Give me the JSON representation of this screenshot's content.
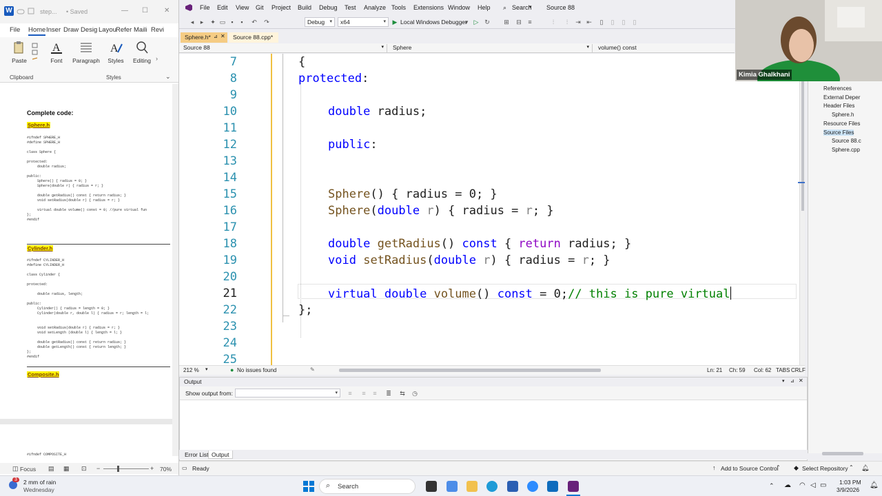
{
  "word": {
    "title_doc": "step...",
    "title_saved": "• Saved",
    "tabs": [
      "File",
      "Home",
      "Inser",
      "Draw",
      "Desig",
      "Layou",
      "Refer",
      "Maili",
      "Revi"
    ],
    "ribbon": {
      "paste": "Paste",
      "font": "Font",
      "paragraph": "Paragraph",
      "styles": "Styles",
      "editing": "Editing",
      "clipboard_group": "Clipboard",
      "styles_group": "Styles"
    },
    "doc": {
      "heading": "Complete code:",
      "sphere_file": "Sphere.h",
      "sphere_code": "#ifndef SPHERE_H\n#define SPHERE_H\n\nclass Sphere {\n\nprotected:\n     double radius;\n\npublic:\n     Sphere() { radius = 0; }\n     Sphere(double r) { radius = r; }\n\n     double getRadius() const { return radius; }\n     void setRadius(double r) { radius = r; }\n\n     virtual double volume() const = 0; //pure virtual fun\n};\n#endif",
      "cylinder_file": "Cylinder.h",
      "cylinder_code": "#ifndef CYLINDER_H\n#define CYLINDER_H\n\nclass Cylinder {\n\nprotected:\n\n     double radius, length;\n\npublic:\n     Cylinder() { radius = length = 0; }\n     Cylinder(double r, double l) { radius = r; length = l;\n\n\n     void setRadius(double r) { radius = r; }\n     void setLength (double l) { length = l; }\n\n     double getRadius() const { return radius; }\n     double getLength() const { return length; }\n};\n#endif",
      "composite_file": "Composite.h",
      "composite_code": "#ifndef COMPOSITE_H"
    },
    "status": {
      "focus": "Focus",
      "zoom": "70%"
    }
  },
  "vs": {
    "menu": [
      "File",
      "Edit",
      "View",
      "Git",
      "Project",
      "Build",
      "Debug",
      "Test",
      "Analyze",
      "Tools",
      "Extensions",
      "Window",
      "Help"
    ],
    "search_label": "Search",
    "solution_title": "Source 88",
    "config": "Debug",
    "platform": "x64",
    "run_label": "Local Windows Debugger",
    "tabs": [
      {
        "label": "Sphere.h*"
      },
      {
        "label": "Source 88.cpp*"
      }
    ],
    "nav": {
      "project": "Source 88",
      "scope": "Sphere",
      "member": "volume() const"
    },
    "code_lines": [
      {
        "n": "7",
        "text": "{"
      },
      {
        "n": "8",
        "text": "protected:"
      },
      {
        "n": "9",
        "text": ""
      },
      {
        "n": "10",
        "text": "double radius;"
      },
      {
        "n": "11",
        "text": ""
      },
      {
        "n": "12",
        "text": "public:"
      },
      {
        "n": "13",
        "text": ""
      },
      {
        "n": "14",
        "text": ""
      },
      {
        "n": "15",
        "text": "Sphere() { radius = 0; }"
      },
      {
        "n": "16",
        "text": "Sphere(double r) { radius = r; }"
      },
      {
        "n": "17",
        "text": ""
      },
      {
        "n": "18",
        "text": "double getRadius() const { return radius; }"
      },
      {
        "n": "19",
        "text": "void setRadius(double r) { radius = r; }"
      },
      {
        "n": "20",
        "text": ""
      },
      {
        "n": "21",
        "text": "virtual double volume() const = 0;// this is pure virtual"
      },
      {
        "n": "22",
        "text": "};"
      },
      {
        "n": "23",
        "text": ""
      },
      {
        "n": "24",
        "text": ""
      },
      {
        "n": "25",
        "text": ""
      }
    ],
    "editor_status": {
      "zoom": "212 %",
      "issues": "No issues found",
      "ln": "Ln: 21",
      "ch": "Ch: 59",
      "col": "Col: 62",
      "tabs": "TABS",
      "eol": "CRLF"
    },
    "output": {
      "title": "Output",
      "show_from": "Show output from:"
    },
    "bottom_tabs": [
      "Error List",
      "Output"
    ],
    "solution_items": [
      {
        "label": "References",
        "level": 1
      },
      {
        "label": "External Deper",
        "level": 1
      },
      {
        "label": "Header Files",
        "level": 1
      },
      {
        "label": "Sphere.h",
        "level": 2
      },
      {
        "label": "Resource Files",
        "level": 1
      },
      {
        "label": "Source Files",
        "level": 1
      },
      {
        "label": "Source 88.c",
        "level": 2
      },
      {
        "label": "Sphere.cpp",
        "level": 2
      }
    ],
    "status": {
      "ready": "Ready",
      "add_source": "Add to Source Control",
      "select_repo": "Select Repository"
    }
  },
  "webcam": {
    "name": "Kimia Ghalkhani"
  },
  "taskbar": {
    "weather_temp": "2 mm of rain",
    "weather_day": "Wednesday",
    "search": "Search",
    "time": "1:03 PM",
    "date": "3/9/2026",
    "badge": "3"
  }
}
